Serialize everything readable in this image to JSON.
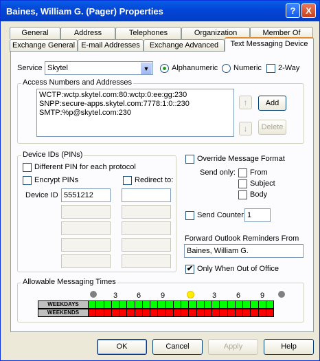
{
  "window": {
    "title": "Baines, William G. (Pager) Properties",
    "help_btn": "?",
    "close_btn": "X"
  },
  "tabs_row1": [
    "General",
    "Address",
    "Telephones",
    "Organization",
    "Member Of"
  ],
  "tabs_row2": [
    "Exchange General",
    "E-mail Addresses",
    "Exchange Advanced",
    "Text Messaging Device"
  ],
  "service": {
    "label": "Service",
    "value": "Skytel",
    "alphanumeric": "Alphanumeric",
    "numeric": "Numeric",
    "twoway": "2-Way",
    "selected_mode": "Alphanumeric"
  },
  "access": {
    "group_label": "Access Numbers and Addresses",
    "lines": [
      "WCTP:wctp.skytel.com:80:wctp:0:ee:gg:230",
      "SNPP:secure-apps.skytel.com:7778:1:0::230",
      "SMTP:%p@skytel.com:230"
    ],
    "add": "Add",
    "delete": "Delete"
  },
  "device_ids": {
    "group_label": "Device IDs (PINs)",
    "different_pin": "Different PIN for each protocol",
    "encrypt": "Encrypt PINs",
    "redirect": "Redirect to:",
    "device_id_label": "Device ID",
    "device_id_value": "5551212"
  },
  "override": {
    "label": "Override Message Format",
    "send_only": "Send only:",
    "from": "From",
    "subject": "Subject",
    "body": "Body",
    "send_counter": "Send Counter",
    "counter_value": "1",
    "forward_label": "Forward Outlook Reminders From",
    "forward_value": "Baines, William G.",
    "only_when_label": "Only When Out of Office",
    "only_when_checked": "✔"
  },
  "times": {
    "group_label": "Allowable Messaging Times",
    "hour_labels": [
      "3",
      "6",
      "9",
      "3",
      "6",
      "9"
    ],
    "weekdays": "WEEKDAYS",
    "weekends": "WEEKENDS",
    "weekday_allowed": [
      1,
      1,
      1,
      1,
      1,
      1,
      1,
      1,
      1,
      1,
      1,
      1,
      1,
      1,
      1,
      1,
      1,
      1,
      1,
      1,
      1,
      1,
      1,
      1
    ],
    "weekend_allowed": [
      0,
      0,
      0,
      0,
      0,
      0,
      0,
      0,
      0,
      0,
      0,
      0,
      0,
      0,
      0,
      0,
      0,
      0,
      0,
      0,
      0,
      0,
      0,
      0
    ],
    "allowed_color": "#00ff00",
    "blocked_color": "#ff0000"
  },
  "buttons": {
    "ok": "OK",
    "cancel": "Cancel",
    "apply": "Apply",
    "help": "Help"
  }
}
